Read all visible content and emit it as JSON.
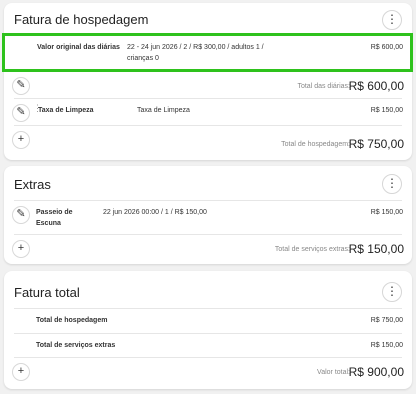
{
  "lodging": {
    "title": "Fatura de hospedagem",
    "rate_row": {
      "label": "Valor original das diárias",
      "details_line1": "22 - 24 jun 2026  /  2  /  R$ 300,00  /  adultos 1  /",
      "details_line2": "crianças 0",
      "amount": "R$ 600,00"
    },
    "subtotal_label": "Total das diárias:",
    "subtotal_value": "R$ 600,00",
    "fee_row": {
      "label": "Taxa de Limpeza",
      "description": "Taxa de Limpeza",
      "amount": "R$ 150,00"
    },
    "total_label": "Total de hospedagem:",
    "total_value": "R$ 750,00"
  },
  "extras": {
    "title": "Extras",
    "item": {
      "label_line1": "Passeio de",
      "label_line2": "Escuna",
      "details": "22 jun 2026 00:00  /  1  /  R$ 150,00",
      "amount": "R$ 150,00"
    },
    "total_label": "Total de serviços extras:",
    "total_value": "R$ 150,00"
  },
  "summary": {
    "title": "Fatura total",
    "rows": [
      {
        "label": "Total de hospedagem",
        "amount": "R$ 750,00"
      },
      {
        "label": "Total de serviços extras",
        "amount": "R$ 150,00"
      }
    ],
    "total_label": "Valor total:",
    "total_value": "R$ 900,00"
  },
  "icons": {
    "menu": "vertical-dots-icon",
    "edit": "pencil-icon",
    "add": "plus-icon",
    "drag": "drag-handle-icon"
  },
  "colors": {
    "highlight": "#2ec21c"
  }
}
